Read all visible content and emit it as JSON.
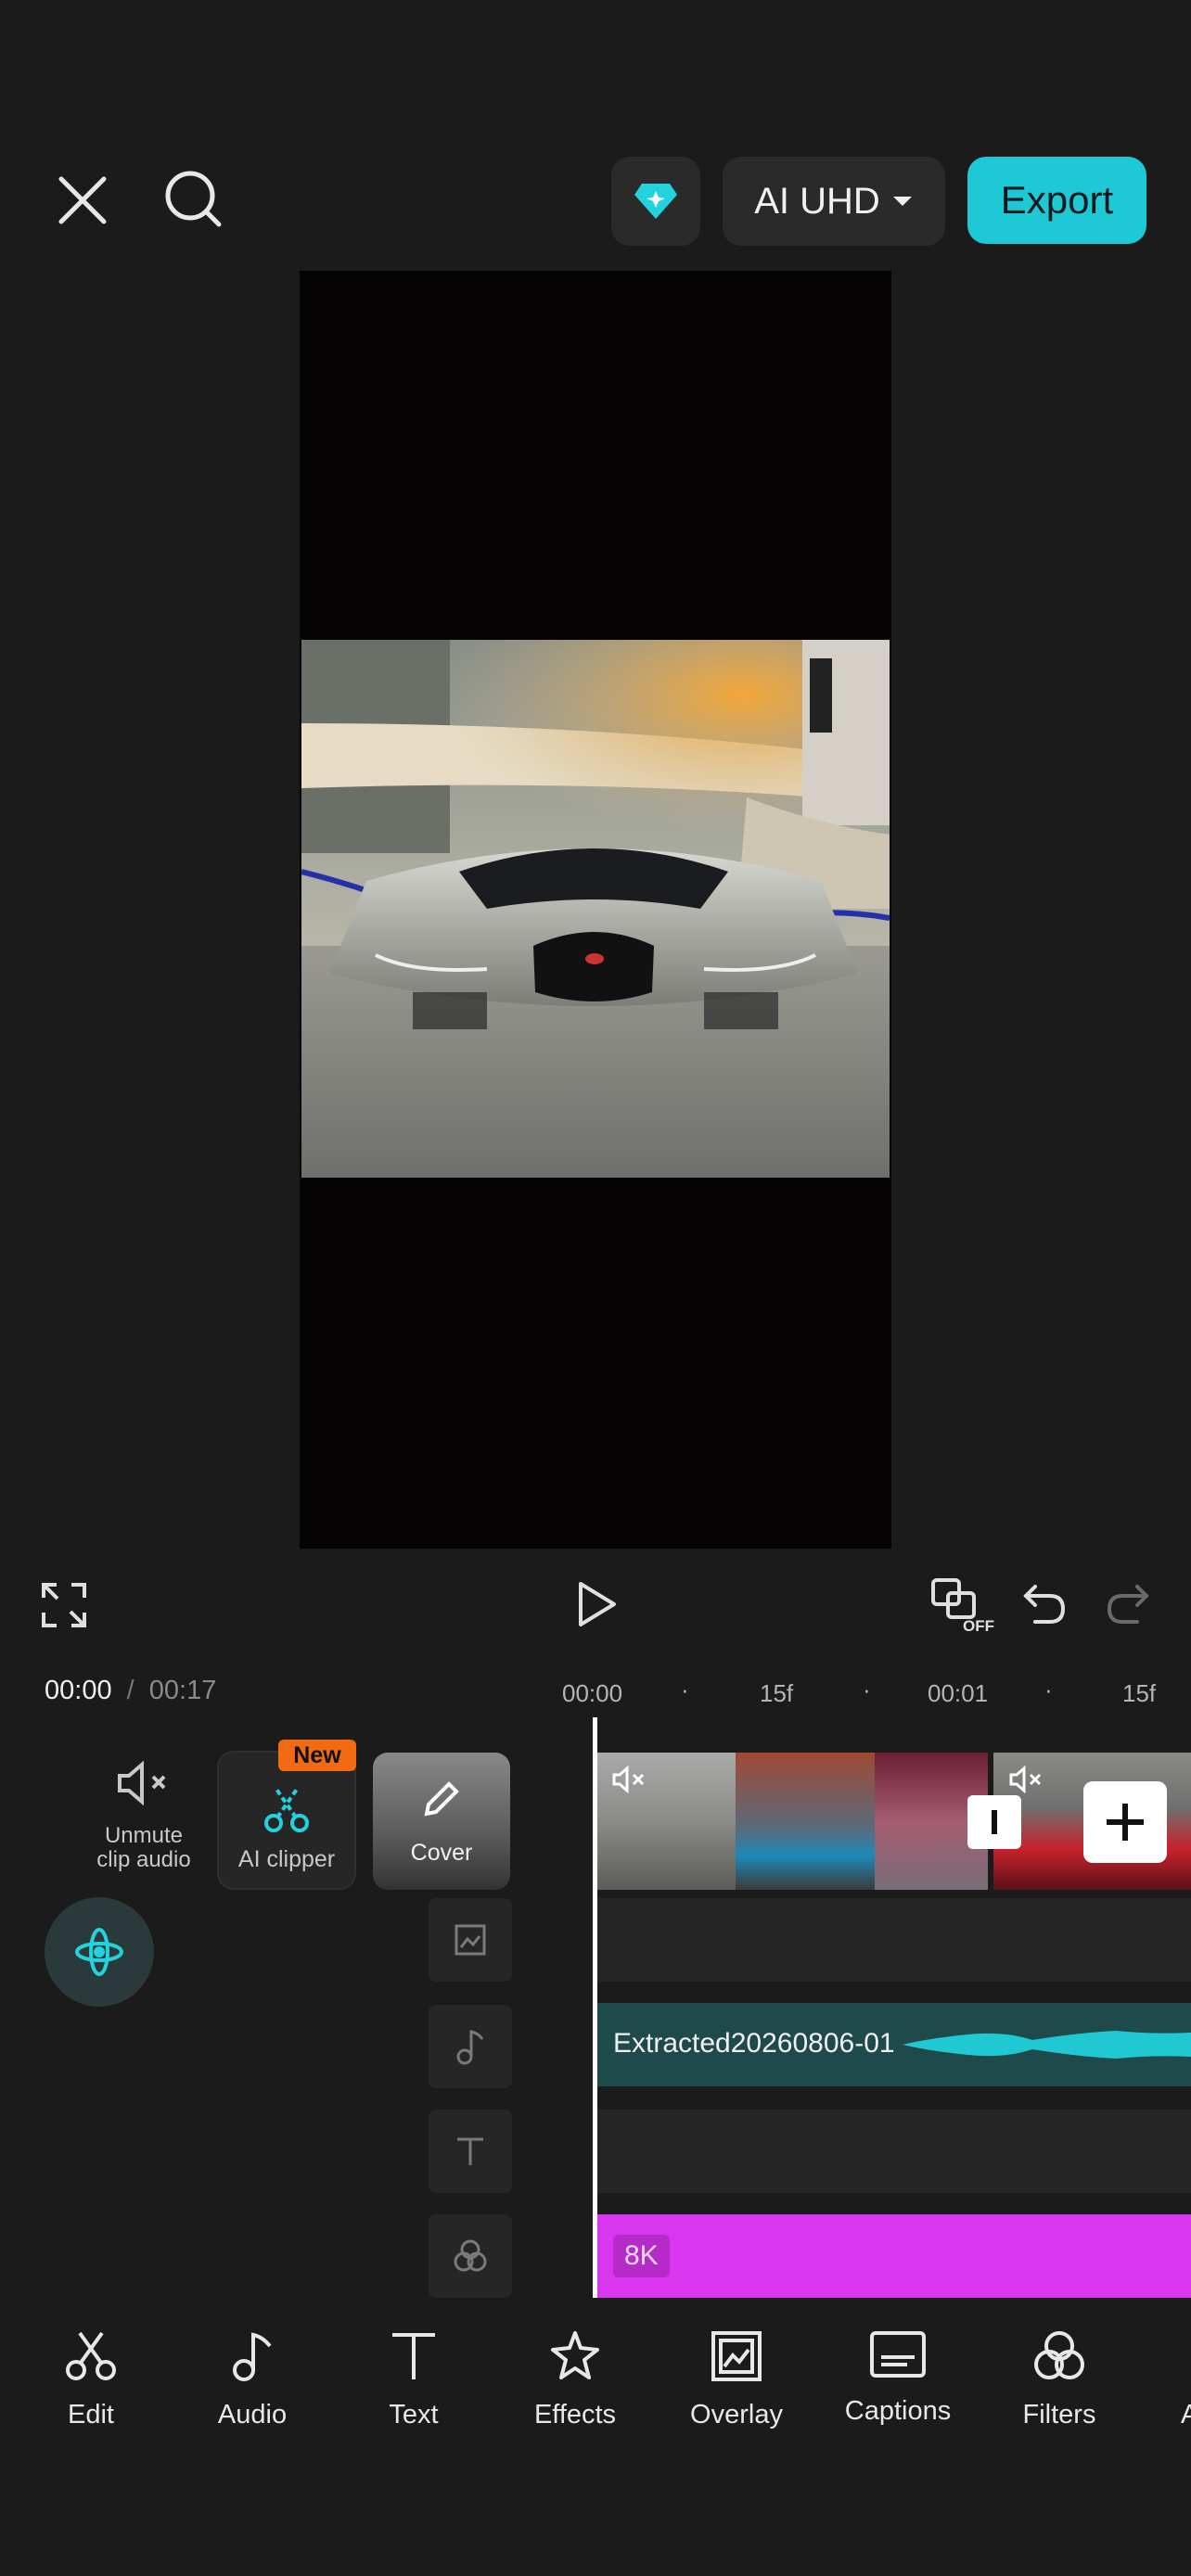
{
  "header": {
    "close_icon": "close-icon",
    "search_icon": "search-icon",
    "pro_icon": "diamond-icon",
    "resolution_label": "AI UHD",
    "export_label": "Export"
  },
  "playback": {
    "current_time": "00:00",
    "separator": "/",
    "total_time": "00:17",
    "snap_badge": "OFF"
  },
  "ruler": {
    "ticks": [
      "00:00",
      "15f",
      "00:01",
      "15f"
    ]
  },
  "timeline_tools": {
    "unmute_label": "Unmute\nclip audio",
    "ai_clipper_label": "AI clipper",
    "new_badge": "New",
    "cover_label": "Cover"
  },
  "tracks": {
    "audio_clip_label": "Extracted20260806-01",
    "effect_clip_label": "8K"
  },
  "toolbar": {
    "items": [
      {
        "label": "Edit",
        "icon": "scissors-icon"
      },
      {
        "label": "Audio",
        "icon": "music-note-icon"
      },
      {
        "label": "Text",
        "icon": "text-icon"
      },
      {
        "label": "Effects",
        "icon": "star-icon"
      },
      {
        "label": "Overlay",
        "icon": "overlay-icon"
      },
      {
        "label": "Captions",
        "icon": "captions-icon"
      },
      {
        "label": "Filters",
        "icon": "filters-icon"
      },
      {
        "label": "A",
        "icon": "partial-icon"
      }
    ]
  },
  "colors": {
    "accent": "#1ec8d4",
    "export_bg": "#1ec8d4",
    "background": "#1b1b1b",
    "audio_track": "#1f4a4c",
    "audio_wave": "#20c9d1",
    "effect_track": "#d936f0",
    "new_badge": "#f26a12"
  }
}
